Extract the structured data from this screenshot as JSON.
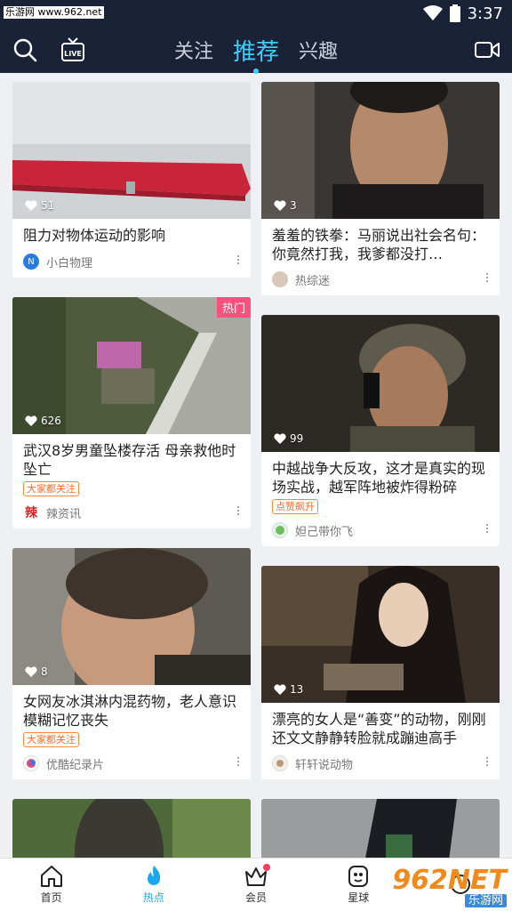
{
  "status_bar": {
    "source": "乐游网 www.962.net",
    "time": "3:37"
  },
  "top_nav": {
    "tabs": [
      {
        "label": "关注",
        "active": false
      },
      {
        "label": "推荐",
        "active": true
      },
      {
        "label": "兴趣",
        "active": false
      }
    ],
    "left_icons": [
      "search-icon",
      "live-tv-icon"
    ],
    "right_icons": [
      "video-camera-icon"
    ]
  },
  "feed": {
    "left": [
      {
        "likes": "51",
        "title": "阻力对物体运动的影响",
        "author": "小白物理",
        "hot": "",
        "tag": ""
      },
      {
        "likes": "626",
        "title": "武汉8岁男童坠楼存活 母亲救他时坠亡",
        "author": "辣资讯",
        "hot": "热门",
        "tag": "大家都关注"
      },
      {
        "likes": "8",
        "title": "女网友冰淇淋内混药物，老人意识模糊记忆丧失",
        "author": "优酷纪录片",
        "hot": "",
        "tag": "大家都关注"
      },
      {
        "likes": "",
        "title": "",
        "author": "",
        "hot": "",
        "tag": ""
      }
    ],
    "right": [
      {
        "likes": "3",
        "title": "羞羞的铁拳：马丽说出社会名句：你竟然打我，我爹都没打…",
        "author": "热综迷",
        "hot": "",
        "tag": ""
      },
      {
        "likes": "99",
        "title": "中越战争大反攻，这才是真实的现场实战，越军阵地被炸得粉碎",
        "author": "妲己带你飞",
        "hot": "",
        "tag": "点赞飙升"
      },
      {
        "likes": "13",
        "title": "漂亮的女人是“善变”的动物，刚刚还文文静静转脸就成蹦迪高手",
        "author": "轩轩说动物",
        "hot": "",
        "tag": ""
      },
      {
        "likes": "",
        "title": "",
        "author": "",
        "hot": "",
        "tag": ""
      }
    ]
  },
  "bottom_nav": [
    {
      "label": "首页",
      "icon": "home-icon",
      "active": false
    },
    {
      "label": "热点",
      "icon": "flame-icon",
      "active": true
    },
    {
      "label": "会员",
      "icon": "crown-icon",
      "active": false,
      "dot": true
    },
    {
      "label": "星球",
      "icon": "planet-icon",
      "active": false
    },
    {
      "label": "",
      "icon": "more-icon",
      "active": false
    }
  ],
  "watermark": {
    "big": "962NET",
    "small": "乐游网"
  },
  "colors": {
    "header_bg": "#1a2237",
    "accent": "#3ad0ff",
    "tag_orange": "#ff6a2a",
    "hot_pink": "#ff4f7d"
  }
}
